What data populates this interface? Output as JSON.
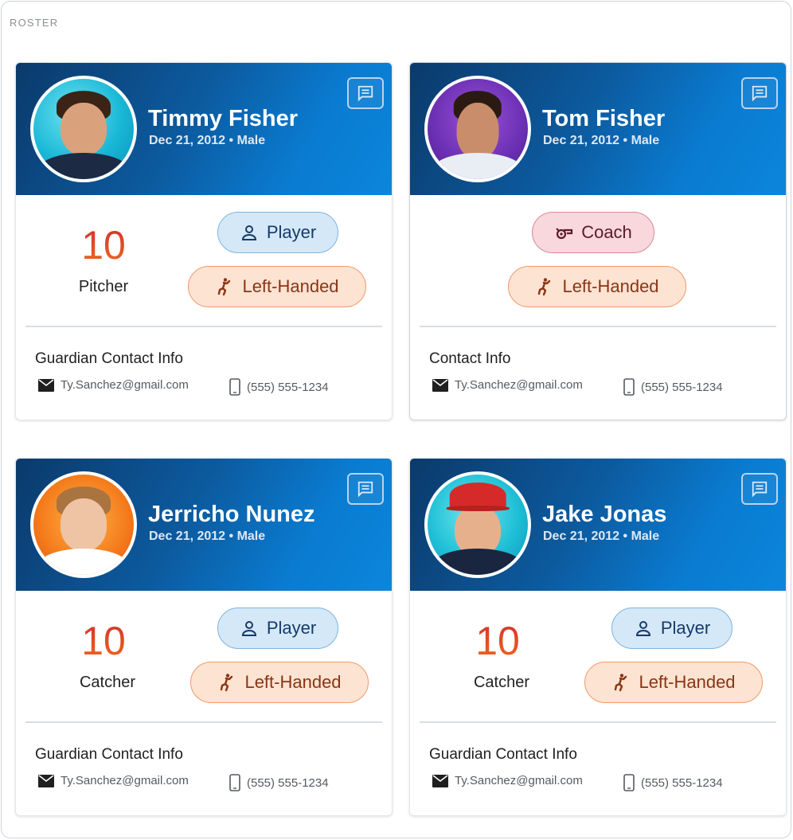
{
  "section_label": "ROSTER",
  "colors": {
    "header_gradient_start": "#0b3a6b",
    "header_gradient_end": "#0b86db",
    "number_gradient": [
      "#d42d2d",
      "#ef6a1f"
    ],
    "player_pill": "#d4e8f7",
    "coach_pill": "#f8d7dd",
    "lefty_pill": "#fde3d2"
  },
  "cards": [
    {
      "name": "Timmy Fisher",
      "details": "Dec 21, 2012 • Male",
      "number": "10",
      "position": "Pitcher",
      "role": "Player",
      "role_icon": "person-icon",
      "handedness": "Left-Handed",
      "handedness_icon": "pitcher-icon",
      "contact_title": "Guardian Contact Info",
      "email": "Ty.Sanchez@gmail.com",
      "phone": "(555) 555-1234"
    },
    {
      "name": "Tom Fisher",
      "details": "Dec 21, 2012 • Male",
      "role": "Coach",
      "role_icon": "whistle-icon",
      "handedness": "Left-Handed",
      "handedness_icon": "pitcher-icon",
      "contact_title": "Contact Info",
      "email": "Ty.Sanchez@gmail.com",
      "phone": "(555) 555-1234"
    },
    {
      "name": "Jerricho Nunez",
      "details": "Dec 21, 2012 • Male",
      "number": "10",
      "position": "Catcher",
      "role": "Player",
      "role_icon": "person-icon",
      "handedness": "Left-Handed",
      "handedness_icon": "pitcher-icon",
      "contact_title": "Guardian Contact Info",
      "email": "Ty.Sanchez@gmail.com",
      "phone": "(555) 555-1234"
    },
    {
      "name": "Jake Jonas",
      "details": "Dec 21, 2012 • Male",
      "number": "10",
      "position": "Catcher",
      "role": "Player",
      "role_icon": "person-icon",
      "handedness": "Left-Handed",
      "handedness_icon": "pitcher-icon",
      "contact_title": "Guardian Contact Info",
      "email": "Ty.Sanchez@gmail.com",
      "phone": "(555) 555-1234"
    }
  ]
}
